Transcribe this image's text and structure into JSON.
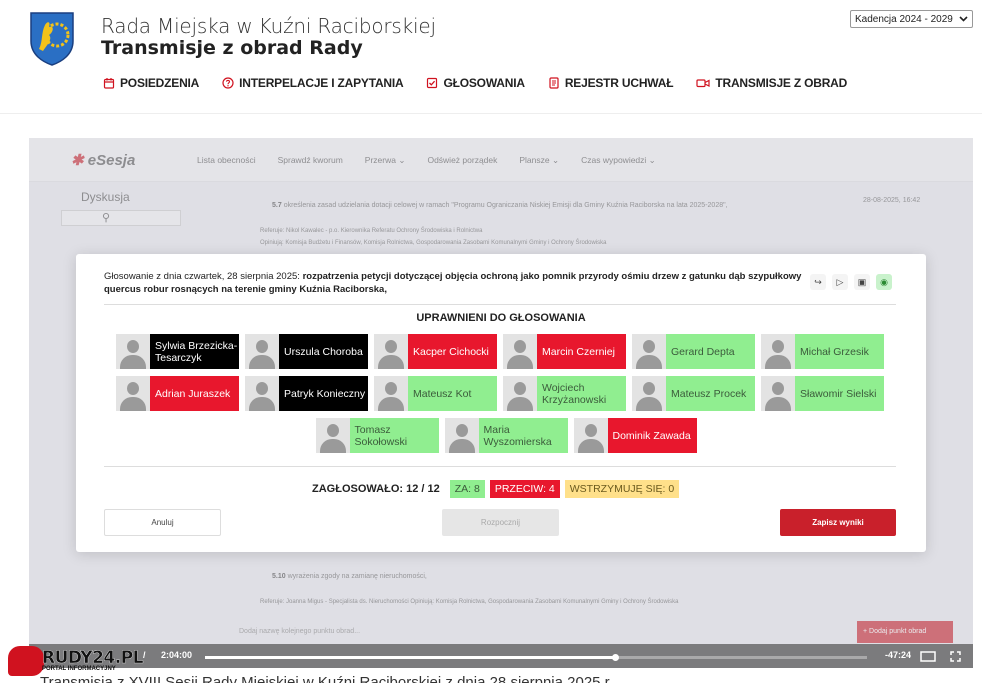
{
  "header": {
    "title": "Rada Miejska w Kuźni Raciborskiej",
    "subtitle": "Transmisje z obrad Rady",
    "kadencja_select": "Kadencja 2024 - 2029"
  },
  "nav": [
    {
      "label": "POSIEDZENIA",
      "icon": "calendar-icon"
    },
    {
      "label": "INTERPELACJE I ZAPYTANIA",
      "icon": "question-icon"
    },
    {
      "label": "GŁOSOWANIA",
      "icon": "checkbox-icon"
    },
    {
      "label": "REJESTR UCHWAŁ",
      "icon": "document-icon"
    },
    {
      "label": "TRANSMISJE Z OBRAD",
      "icon": "video-camera-icon"
    }
  ],
  "app": {
    "logo": "eSesja",
    "menu": [
      "Lista obecności",
      "Sprawdź kworum",
      "Przerwa ⌄",
      "Odśwież porządek",
      "Plansze ⌄",
      "Czas wypowiedzi ⌄"
    ],
    "sidebar_title": "Dyskusja",
    "agenda_top": {
      "number": "5.7",
      "text": "określenia zasad udzielania dotacji celowej w ramach \"Programu Ograniczania Niskiej Emisji dla Gminy Kuźnia Raciborska na lata 2025-2028\",",
      "timestamp": "28-08-2025, 16:42",
      "referent": "Referuje: Nikol Kawalec - p.o. Kierownika Referatu Ochrony Środowiska i Rolnictwa",
      "opinion": "Opiniują: Komisja Budżetu i Finansów, Komisja Rolnictwa, Gospodarowania Zasobami Komunalnymi Gminy i Ochrony Środowiska"
    },
    "agenda_bottom": {
      "number": "5.10",
      "text": "wyrażenia zgody na zamianę nieruchomości,",
      "referent": "Referuje: Joanna Migus - Specjalista ds. Nieruchomości  Opiniują: Komisja Rolnictwa, Gospodarowania Zasobami Komunalnymi Gminy i Ochrony Środowiska"
    },
    "add_point_placeholder": "Dodaj nazwę kolejnego punktu obrad...",
    "add_point_button": "+ Dodaj punkt obrad"
  },
  "modal": {
    "heading_prefix": "Głosowanie z dnia czwartek, 28 sierpnia 2025: ",
    "heading_bold": "rozpatrzenia petycji dotyczącej objęcia ochroną jako pomnik przyrody ośmiu drzew z gatunku dąb szypułkowy quercus robur rosnących na terenie gminy Kuźnia Raciborska,",
    "section_title": "UPRAWNIENI DO GŁOSOWANIA",
    "voters_rows": [
      [
        {
          "name": "Sylwia Brzezicka-Tesarczyk",
          "vote": "absent"
        },
        {
          "name": "Urszula Choroba",
          "vote": "absent"
        },
        {
          "name": "Kacper Cichocki",
          "vote": "przeciw"
        },
        {
          "name": "Marcin Czerniej",
          "vote": "przeciw"
        },
        {
          "name": "Gerard Depta",
          "vote": "za"
        },
        {
          "name": "Michał Grzesik",
          "vote": "za"
        }
      ],
      [
        {
          "name": "Adrian Juraszek",
          "vote": "przeciw"
        },
        {
          "name": "Patryk Konieczny",
          "vote": "absent"
        },
        {
          "name": "Mateusz Kot",
          "vote": "za"
        },
        {
          "name": "Wojciech Krzyżanowski",
          "vote": "za"
        },
        {
          "name": "Mateusz Procek",
          "vote": "za"
        },
        {
          "name": "Sławomir Sielski",
          "vote": "za"
        }
      ],
      [
        {
          "name": "Tomasz Sokołowski",
          "vote": "za"
        },
        {
          "name": "Maria Wyszomierska",
          "vote": "za"
        },
        {
          "name": "Dominik Zawada",
          "vote": "przeciw"
        }
      ]
    ],
    "summary_label": "ZAGŁOSOWAŁO: 12 / 12",
    "za": "ZA: 8",
    "przeciw": "PRZECIW: 4",
    "wstrzymuje": "WSTRZYMUJĘ SIĘ: 0",
    "btn_cancel": "Anuluj",
    "btn_reset": "Rozpocznij",
    "btn_save": "Zapisz wyniki"
  },
  "player": {
    "time_current": "2:04:00",
    "time_separator": "/",
    "time_remaining": "-47:24",
    "progress": 0.62
  },
  "watermark": {
    "brand": "RUDY24.PL",
    "tagline": "PORTAL INFORMACYJNY"
  },
  "caption": "Transmisja z XVIII Sesji Rady Miejskiej w Kuźni Raciborskiej z dnia 28 sierpnia 2025 r."
}
